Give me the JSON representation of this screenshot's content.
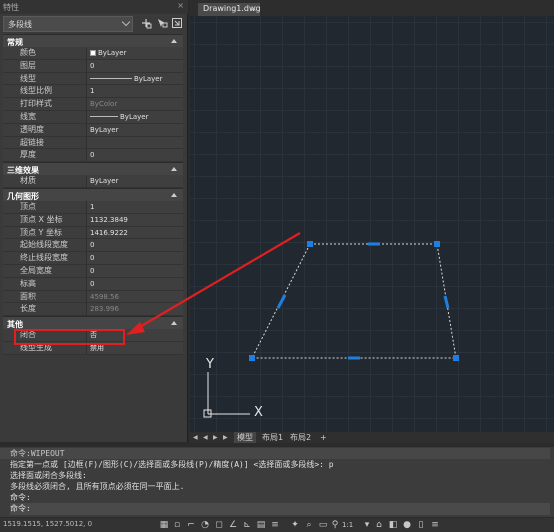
{
  "panel": {
    "title": "特性",
    "close": "×",
    "selection": "多段线",
    "categories": {
      "general": "常规",
      "three_d": "三维效果",
      "geometry": "几何图形",
      "misc": "其他"
    },
    "general_rows": [
      {
        "k": "颜色",
        "v": "ByLayer"
      },
      {
        "k": "图层",
        "v": "0"
      },
      {
        "k": "线型",
        "v": "ByLayer"
      },
      {
        "k": "线型比例",
        "v": "1"
      },
      {
        "k": "打印样式",
        "v": "ByColor"
      },
      {
        "k": "线宽",
        "v": "ByLayer"
      },
      {
        "k": "透明度",
        "v": "ByLayer"
      },
      {
        "k": "超链接",
        "v": ""
      },
      {
        "k": "厚度",
        "v": "0"
      }
    ],
    "three_d_rows": [
      {
        "k": "材质",
        "v": "ByLayer"
      }
    ],
    "geometry_rows": [
      {
        "k": "顶点",
        "v": "1"
      },
      {
        "k": "顶点 X 坐标",
        "v": "1132.3849"
      },
      {
        "k": "顶点 Y 坐标",
        "v": "1416.9222"
      },
      {
        "k": "起始线段宽度",
        "v": "0"
      },
      {
        "k": "终止线段宽度",
        "v": "0"
      },
      {
        "k": "全局宽度",
        "v": "0"
      },
      {
        "k": "标高",
        "v": "0"
      },
      {
        "k": "面积",
        "v": "4598.56"
      },
      {
        "k": "长度",
        "v": "283.996"
      }
    ],
    "misc_rows": [
      {
        "k": "闭合",
        "v": "否"
      },
      {
        "k": "线型生成",
        "v": "禁用"
      }
    ]
  },
  "doc_tab": {
    "title": "Drawing1.dwg",
    "close": "×"
  },
  "layout_tabs": [
    "模型",
    "布局1",
    "布局2",
    "+"
  ],
  "ucs": {
    "x": "X",
    "y": "Y"
  },
  "command": {
    "history": [
      "命令:WIPEOUT",
      "指定第一点或 [边框(F)/图形(C)/选择面或多段线(P)/精度(A)] <选择面或多段线>: p",
      "选择面或闭合多段线:",
      "多段线必须闭合, 且所有顶点必须在同一平面上.",
      "命令:"
    ],
    "prompt": "命令:"
  },
  "status": {
    "coords": "1519.1515, 1527.5012, 0",
    "scale": "1:1"
  },
  "colors": {
    "polyline": "#d9d9d9",
    "grip": "#1e7fe0",
    "arrow": "#e02020"
  }
}
